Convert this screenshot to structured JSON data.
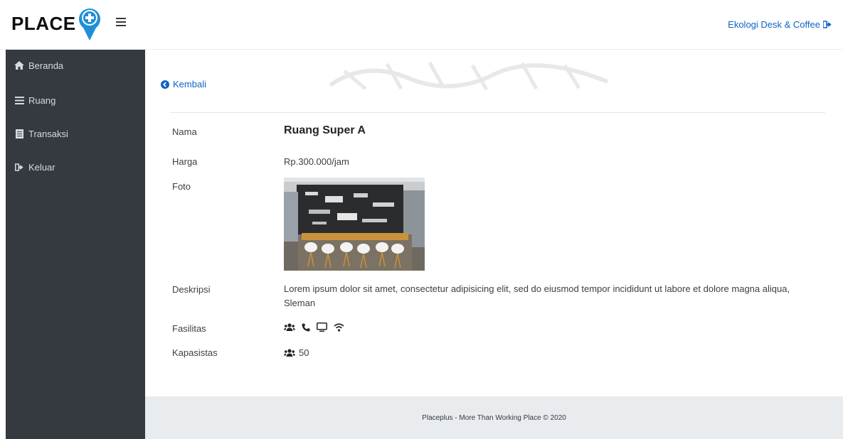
{
  "header": {
    "logo_text": "PLACE",
    "store_name": "Ekologi Desk & Coffee"
  },
  "sidebar": {
    "items": [
      {
        "label": "Beranda",
        "icon": "home-icon"
      },
      {
        "label": "Ruang",
        "icon": "bars-icon"
      },
      {
        "label": "Transaksi",
        "icon": "document-icon"
      },
      {
        "label": "Keluar",
        "icon": "sign-out-icon"
      }
    ]
  },
  "main": {
    "back_label": "Kembali",
    "details": {
      "nama_label": "Nama",
      "nama_value": "Ruang Super A",
      "harga_label": "Harga",
      "harga_value": "Rp.300.000/jam",
      "foto_label": "Foto",
      "deskripsi_label": "Deskripsi",
      "deskripsi_value": "Lorem ipsum dolor sit amet, consectetur adipisicing elit, sed do eiusmod tempor incididunt ut labore et dolore magna aliqua, Sleman",
      "fasilitas_label": "Fasilitas",
      "fasilitas_icons": [
        "users-icon",
        "phone-icon",
        "monitor-icon",
        "wifi-icon"
      ],
      "kapasitas_label": "Kapasistas",
      "kapasitas_value": "50"
    }
  },
  "footer": {
    "text": "Placeplus - More Than Working Place © 2020"
  },
  "colors": {
    "link": "#0f63c5",
    "sidebar_bg": "#343a40",
    "footer_bg": "#e9ecef",
    "logo_pin": "#1f8fd8"
  }
}
